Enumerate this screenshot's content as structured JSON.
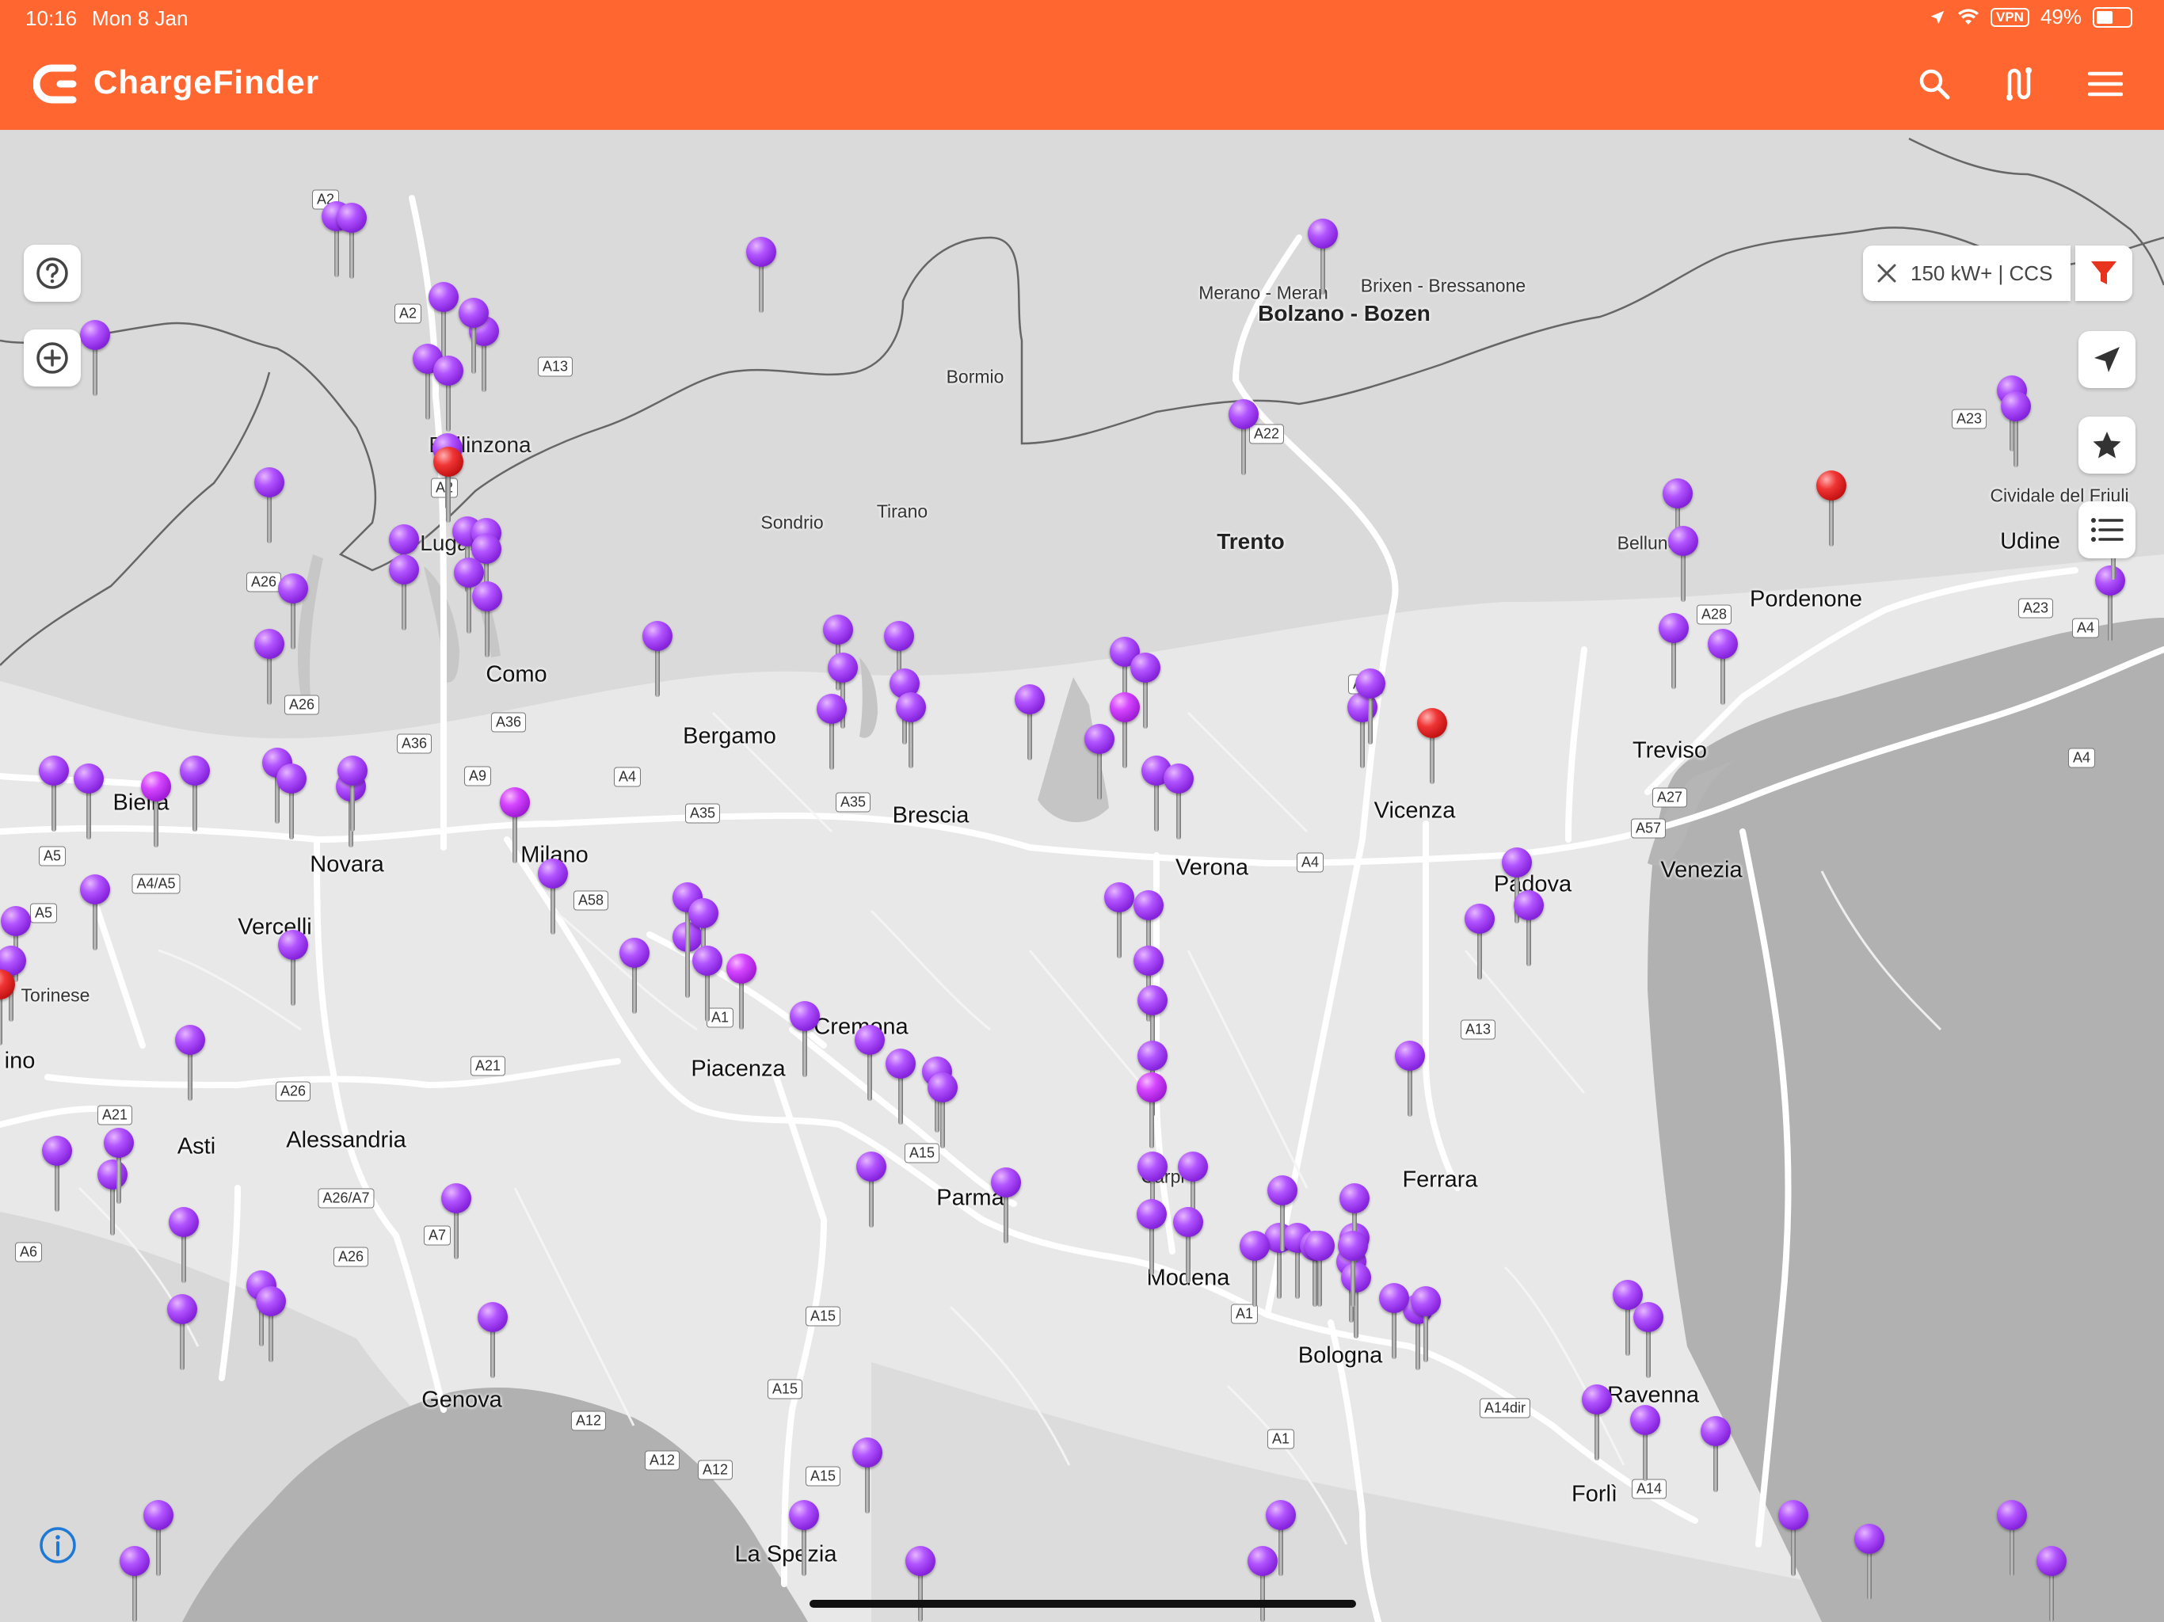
{
  "status_bar": {
    "time": "10:16",
    "date": "Mon 8 Jan",
    "vpn": "VPN",
    "battery": "49%",
    "battery_level": 0.49
  },
  "app": {
    "title": "ChargeFinder",
    "accent": "#ff6630"
  },
  "toolbar": {
    "search_icon": "search-icon",
    "route_icon": "route-icon",
    "menu_icon": "menu-icon"
  },
  "filter": {
    "label": "150 kW+ | CCS",
    "clear_icon": "close-icon",
    "filter_icon": "funnel-icon"
  },
  "map_controls": [
    "help-icon",
    "zoom-in-icon",
    "locate-icon",
    "favorites-icon",
    "list-icon",
    "info-icon"
  ],
  "cities": [
    "Bolzano - Bozen",
    "Trento",
    "Milano",
    "Bergamo",
    "Brescia",
    "Verona",
    "Vicenza",
    "Padova",
    "Venezia",
    "Treviso",
    "Pordenone",
    "Udine",
    "Como",
    "Lugano",
    "Bellinzona",
    "Novara",
    "Vercelli",
    "Biella",
    "Asti",
    "Alessandria",
    "Genova",
    "La Spezia",
    "Piacenza",
    "Cremona",
    "Parma",
    "Modena",
    "Bologna",
    "Ferrara",
    "Ravenna",
    "Forlì",
    "Carpi",
    "Sondrio",
    "Tirano",
    "Bormio",
    "Belluno",
    "Merano - Meran",
    "Brixen - Bressanone",
    "Cividale del Friuli",
    "Torinese",
    "ino"
  ],
  "roads": [
    "A2",
    "A2",
    "A13",
    "A2",
    "A26",
    "A26",
    "A36",
    "A9",
    "A4",
    "A35",
    "A35",
    "A4",
    "A31",
    "A22",
    "A28",
    "A23",
    "A4",
    "A27",
    "A57",
    "A13",
    "A58",
    "A21",
    "A21",
    "A1",
    "A15",
    "A26/A7",
    "A7",
    "A26",
    "A6",
    "A5",
    "A5",
    "A4/A5",
    "A15",
    "A15",
    "A12",
    "A12",
    "A15",
    "A1",
    "A1",
    "A14dir",
    "A14",
    "A23",
    "A12",
    "A4",
    "A26",
    "A36"
  ],
  "station_colors": {
    "standard": "#9b30ee",
    "highlight": "#d040ff",
    "selected": "#e02020"
  }
}
